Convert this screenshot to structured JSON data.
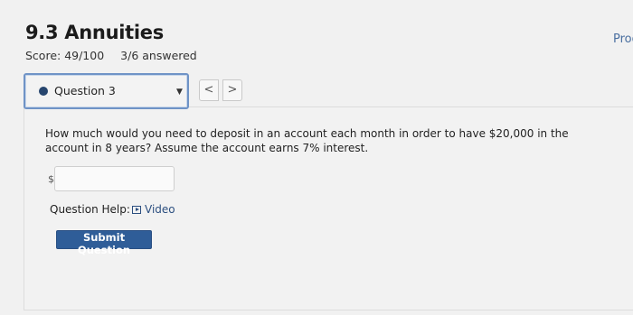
{
  "header": {
    "title": "9.3 Annuities",
    "progress_link_text": "Prog",
    "score": "Score: 49/100",
    "answered": "3/6 answered"
  },
  "question_nav": {
    "selected": "Question 3",
    "prev_label": "<",
    "next_label": ">"
  },
  "question": {
    "text": "How much would you need to deposit in an account each month in order to have $20,000 in the account in 8 years? Assume the account earns 7% interest.",
    "currency_symbol": "$",
    "answer_value": "",
    "help_label": "Question Help:",
    "video_label": "Video",
    "submit_label": "Submit Question"
  },
  "colors": {
    "accent": "#2f5d98",
    "link": "#2c4f80"
  }
}
